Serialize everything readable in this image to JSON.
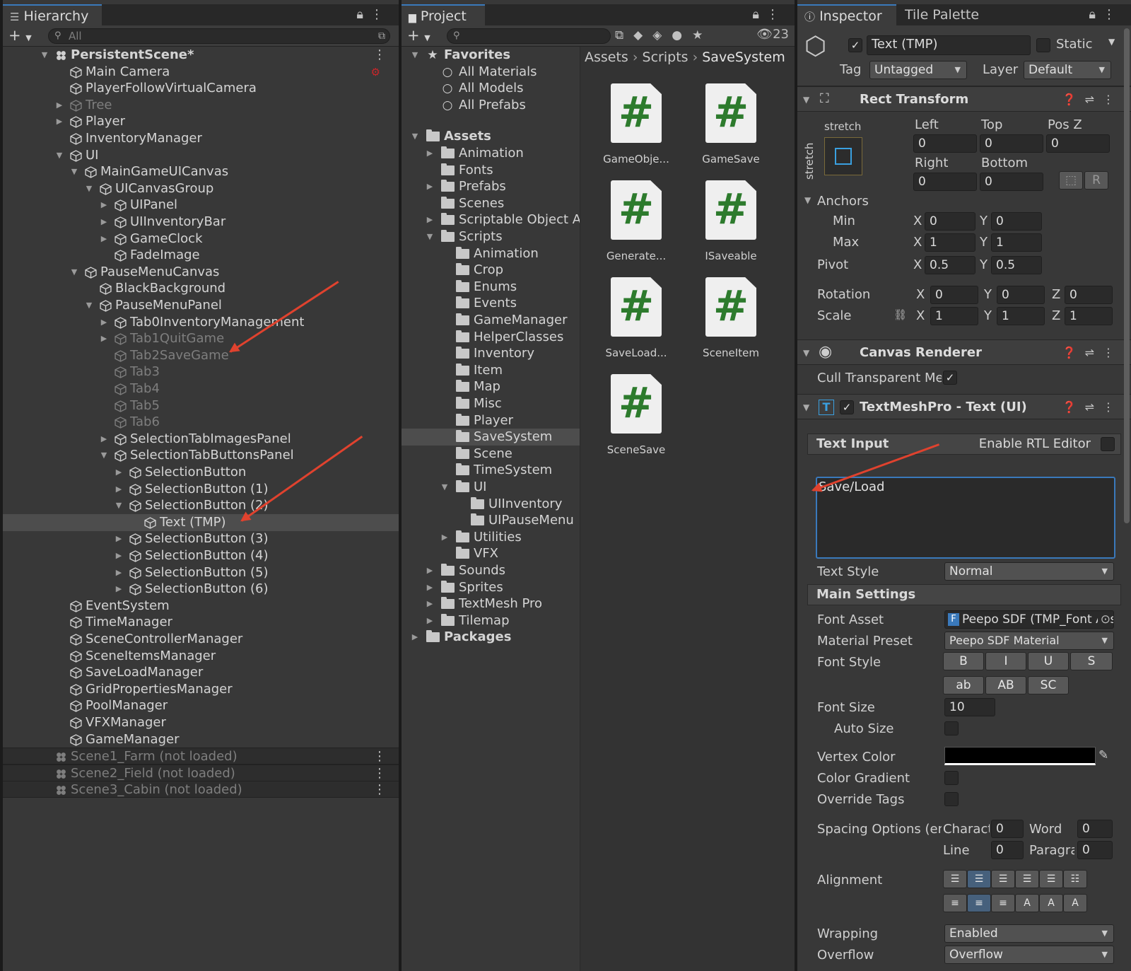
{
  "hierarchy": {
    "tab": "Hierarchy",
    "search_placeholder": "All",
    "rows": [
      {
        "label": "PersistentScene*",
        "depth": 0,
        "arrow": "open",
        "kind": "scene",
        "bold": true
      },
      {
        "label": "Main Camera",
        "depth": 1,
        "kind": "obj",
        "camera": true
      },
      {
        "label": "PlayerFollowVirtualCamera",
        "depth": 1,
        "kind": "obj"
      },
      {
        "label": "Tree",
        "depth": 1,
        "arrow": "closed",
        "kind": "obj",
        "dim": true
      },
      {
        "label": "Player",
        "depth": 1,
        "arrow": "closed",
        "kind": "obj"
      },
      {
        "label": "InventoryManager",
        "depth": 1,
        "kind": "obj"
      },
      {
        "label": "UI",
        "depth": 1,
        "arrow": "open",
        "kind": "obj"
      },
      {
        "label": "MainGameUICanvas",
        "depth": 2,
        "arrow": "open",
        "kind": "obj"
      },
      {
        "label": "UICanvasGroup",
        "depth": 3,
        "arrow": "open",
        "kind": "obj"
      },
      {
        "label": "UIPanel",
        "depth": 4,
        "arrow": "closed",
        "kind": "obj"
      },
      {
        "label": "UIInventoryBar",
        "depth": 4,
        "arrow": "closed",
        "kind": "obj"
      },
      {
        "label": "GameClock",
        "depth": 4,
        "arrow": "closed",
        "kind": "obj"
      },
      {
        "label": "FadeImage",
        "depth": 4,
        "kind": "obj"
      },
      {
        "label": "PauseMenuCanvas",
        "depth": 2,
        "arrow": "open",
        "kind": "obj"
      },
      {
        "label": "BlackBackground",
        "depth": 3,
        "kind": "obj"
      },
      {
        "label": "PauseMenuPanel",
        "depth": 3,
        "arrow": "open",
        "kind": "obj"
      },
      {
        "label": "Tab0InventoryManagement",
        "depth": 4,
        "arrow": "closed",
        "kind": "obj"
      },
      {
        "label": "Tab1QuitGame",
        "depth": 4,
        "arrow": "closed",
        "kind": "obj",
        "dim": true
      },
      {
        "label": "Tab2SaveGame",
        "depth": 4,
        "kind": "obj",
        "dim": true
      },
      {
        "label": "Tab3",
        "depth": 4,
        "kind": "obj",
        "dim": true
      },
      {
        "label": "Tab4",
        "depth": 4,
        "kind": "obj",
        "dim": true
      },
      {
        "label": "Tab5",
        "depth": 4,
        "kind": "obj",
        "dim": true
      },
      {
        "label": "Tab6",
        "depth": 4,
        "kind": "obj",
        "dim": true
      },
      {
        "label": "SelectionTabImagesPanel",
        "depth": 4,
        "arrow": "closed",
        "kind": "obj"
      },
      {
        "label": "SelectionTabButtonsPanel",
        "depth": 4,
        "arrow": "open",
        "kind": "obj"
      },
      {
        "label": "SelectionButton",
        "depth": 5,
        "arrow": "closed",
        "kind": "obj"
      },
      {
        "label": "SelectionButton (1)",
        "depth": 5,
        "arrow": "closed",
        "kind": "obj"
      },
      {
        "label": "SelectionButton (2)",
        "depth": 5,
        "arrow": "open",
        "kind": "obj"
      },
      {
        "label": "Text (TMP)",
        "depth": 6,
        "kind": "obj",
        "selected": true
      },
      {
        "label": "SelectionButton (3)",
        "depth": 5,
        "arrow": "closed",
        "kind": "obj"
      },
      {
        "label": "SelectionButton (4)",
        "depth": 5,
        "arrow": "closed",
        "kind": "obj"
      },
      {
        "label": "SelectionButton (5)",
        "depth": 5,
        "arrow": "closed",
        "kind": "obj"
      },
      {
        "label": "SelectionButton (6)",
        "depth": 5,
        "arrow": "closed",
        "kind": "obj"
      },
      {
        "label": "EventSystem",
        "depth": 1,
        "kind": "obj"
      },
      {
        "label": "TimeManager",
        "depth": 1,
        "kind": "obj"
      },
      {
        "label": "SceneControllerManager",
        "depth": 1,
        "kind": "obj"
      },
      {
        "label": "SceneItemsManager",
        "depth": 1,
        "kind": "obj"
      },
      {
        "label": "SaveLoadManager",
        "depth": 1,
        "kind": "obj"
      },
      {
        "label": "GridPropertiesManager",
        "depth": 1,
        "kind": "obj"
      },
      {
        "label": "PoolManager",
        "depth": 1,
        "kind": "obj"
      },
      {
        "label": "VFXManager",
        "depth": 1,
        "kind": "obj"
      },
      {
        "label": "GameManager",
        "depth": 1,
        "kind": "obj"
      },
      {
        "label": "Scene1_Farm (not loaded)",
        "depth": 0,
        "kind": "scene",
        "dim": true,
        "bar": true
      },
      {
        "label": "Scene2_Field (not loaded)",
        "depth": 0,
        "kind": "scene",
        "dim": true,
        "bar": true
      },
      {
        "label": "Scene3_Cabin (not loaded)",
        "depth": 0,
        "kind": "scene",
        "dim": true,
        "bar": true
      }
    ]
  },
  "project": {
    "tab": "Project",
    "hidden_count": "23",
    "tree": [
      {
        "label": "Favorites",
        "depth": 0,
        "arrow": "open",
        "kind": "star",
        "bold": true
      },
      {
        "label": "All Materials",
        "depth": 1,
        "kind": "search"
      },
      {
        "label": "All Models",
        "depth": 1,
        "kind": "search"
      },
      {
        "label": "All Prefabs",
        "depth": 1,
        "kind": "search"
      },
      {
        "label": "",
        "depth": 0,
        "kind": "gap"
      },
      {
        "label": "Assets",
        "depth": 0,
        "arrow": "open",
        "kind": "openfolder",
        "bold": true
      },
      {
        "label": "Animation",
        "depth": 1,
        "arrow": "closed",
        "kind": "folder"
      },
      {
        "label": "Fonts",
        "depth": 1,
        "kind": "folder"
      },
      {
        "label": "Prefabs",
        "depth": 1,
        "arrow": "closed",
        "kind": "folder"
      },
      {
        "label": "Scenes",
        "depth": 1,
        "kind": "folder"
      },
      {
        "label": "Scriptable Object Assets",
        "depth": 1,
        "arrow": "closed",
        "kind": "folder"
      },
      {
        "label": "Scripts",
        "depth": 1,
        "arrow": "open",
        "kind": "openfolder"
      },
      {
        "label": "Animation",
        "depth": 2,
        "kind": "folder"
      },
      {
        "label": "Crop",
        "depth": 2,
        "kind": "folder"
      },
      {
        "label": "Enums",
        "depth": 2,
        "kind": "folder"
      },
      {
        "label": "Events",
        "depth": 2,
        "kind": "folder"
      },
      {
        "label": "GameManager",
        "depth": 2,
        "kind": "folder"
      },
      {
        "label": "HelperClasses",
        "depth": 2,
        "kind": "folder"
      },
      {
        "label": "Inventory",
        "depth": 2,
        "kind": "folder"
      },
      {
        "label": "Item",
        "depth": 2,
        "kind": "folder"
      },
      {
        "label": "Map",
        "depth": 2,
        "kind": "folder"
      },
      {
        "label": "Misc",
        "depth": 2,
        "kind": "folder"
      },
      {
        "label": "Player",
        "depth": 2,
        "kind": "folder"
      },
      {
        "label": "SaveSystem",
        "depth": 2,
        "kind": "folder",
        "selected": true
      },
      {
        "label": "Scene",
        "depth": 2,
        "kind": "folder"
      },
      {
        "label": "TimeSystem",
        "depth": 2,
        "kind": "folder"
      },
      {
        "label": "UI",
        "depth": 2,
        "arrow": "open",
        "kind": "openfolder"
      },
      {
        "label": "UIInventory",
        "depth": 3,
        "kind": "folder"
      },
      {
        "label": "UIPauseMenu",
        "depth": 3,
        "kind": "folder"
      },
      {
        "label": "Utilities",
        "depth": 2,
        "arrow": "closed",
        "kind": "folder"
      },
      {
        "label": "VFX",
        "depth": 2,
        "kind": "folder"
      },
      {
        "label": "Sounds",
        "depth": 1,
        "arrow": "closed",
        "kind": "folder"
      },
      {
        "label": "Sprites",
        "depth": 1,
        "arrow": "closed",
        "kind": "folder"
      },
      {
        "label": "TextMesh Pro",
        "depth": 1,
        "arrow": "closed",
        "kind": "folder"
      },
      {
        "label": "Tilemap",
        "depth": 1,
        "arrow": "closed",
        "kind": "folder"
      },
      {
        "label": "Packages",
        "depth": 0,
        "arrow": "closed",
        "kind": "folder",
        "bold": true
      }
    ],
    "breadcrumb": [
      "Assets",
      "Scripts",
      "SaveSystem"
    ],
    "assets": [
      "GameObje...",
      "GameSave",
      "Generate...",
      "ISaveable",
      "SaveLoad...",
      "SceneItem",
      "SceneSave"
    ]
  },
  "inspector": {
    "tab": "Inspector",
    "tab2": "Tile Palette",
    "object_name": "Text (TMP)",
    "static_label": "Static",
    "tag_label": "Tag",
    "tag_value": "Untagged",
    "layer_label": "Layer",
    "layer_value": "Default",
    "rect": {
      "title": "Rect Transform",
      "stretch": "stretch",
      "left_label": "Left",
      "top_label": "Top",
      "posz_label": "Pos Z",
      "left": "0",
      "top": "0",
      "posz": "0",
      "right_label": "Right",
      "bottom_label": "Bottom",
      "right": "0",
      "bottom": "0",
      "anchors": "Anchors",
      "min": "Min",
      "max": "Max",
      "pivot": "Pivot",
      "min_x": "0",
      "min_y": "0",
      "max_x": "1",
      "max_y": "1",
      "pivot_x": "0.5",
      "pivot_y": "0.5",
      "rotation": "Rotation",
      "scale": "Scale",
      "rot_x": "0",
      "rot_y": "0",
      "rot_z": "0",
      "scale_x": "1",
      "scale_y": "1",
      "scale_z": "1",
      "x": "X",
      "y": "Y",
      "z": "Z",
      "r_btn": "R"
    },
    "canvas_renderer": {
      "title": "Canvas Renderer",
      "cull_label": "Cull Transparent Me"
    },
    "tmp": {
      "title": "TextMeshPro - Text (UI)",
      "text_input": "Text Input",
      "rtl": "Enable RTL Editor",
      "text_value": "Save/Load",
      "text_style_label": "Text Style",
      "text_style": "Normal",
      "main_settings": "Main Settings",
      "font_asset_label": "Font Asset",
      "font_asset": "Peepo SDF (TMP_Font Asset)",
      "material_label": "Material Preset",
      "material": "Peepo SDF Material",
      "font_style_label": "Font Style",
      "style_buttons": [
        "B",
        "I",
        "U",
        "S",
        "ab",
        "AB",
        "SC"
      ],
      "font_size_label": "Font Size",
      "font_size": "10",
      "auto_size_label": "Auto Size",
      "vertex_color_label": "Vertex Color",
      "color_gradient_label": "Color Gradient",
      "override_tags_label": "Override Tags",
      "spacing_label": "Spacing Options (em)",
      "char_label": "Character",
      "char_value": "0",
      "word_label": "Word",
      "word_value": "0",
      "line_label": "Line",
      "line_value": "0",
      "para_label": "Paragraph",
      "para_value": "0",
      "alignment_label": "Alignment",
      "wrapping_label": "Wrapping",
      "wrapping": "Enabled",
      "overflow_label": "Overflow",
      "overflow": "Overflow"
    }
  },
  "colors": {
    "accent": "#3a79bb",
    "arrow": "#e0422e",
    "selection": "#4d4d4d",
    "script_hash": "#2d7b2d"
  }
}
